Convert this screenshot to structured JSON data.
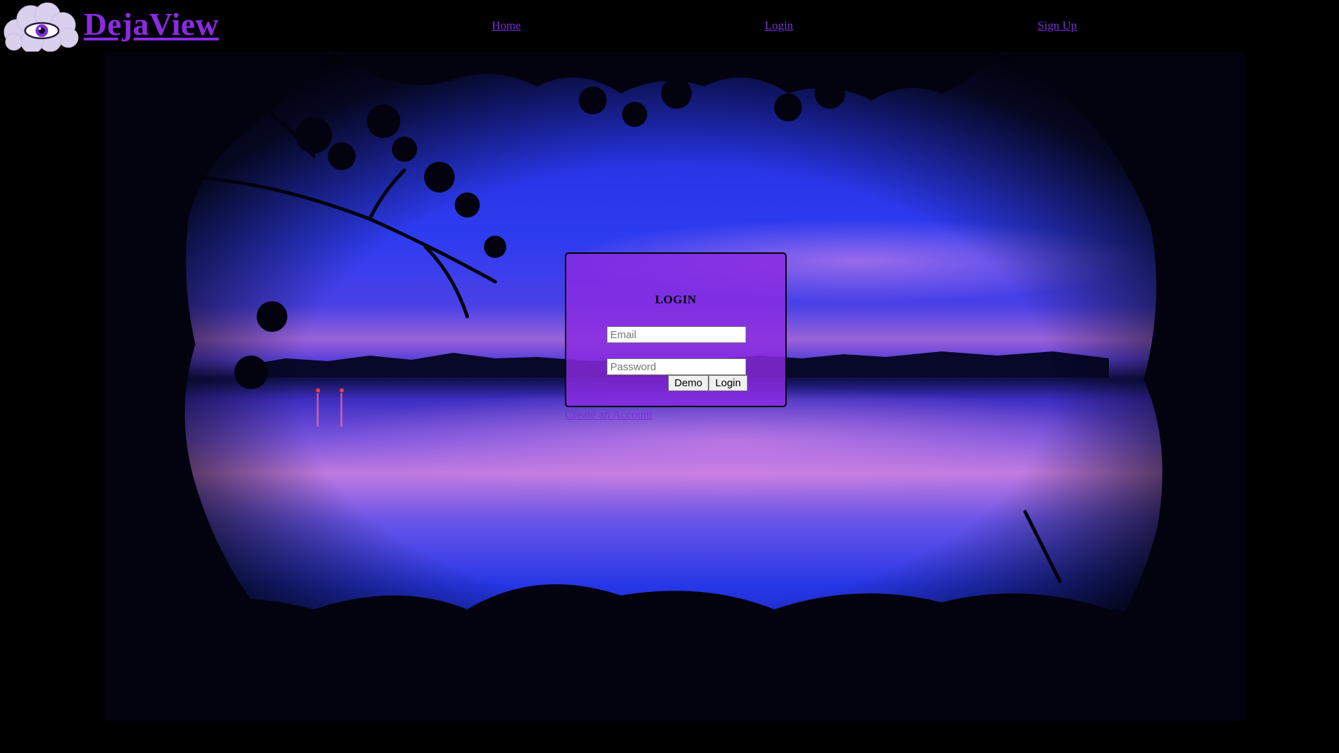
{
  "header": {
    "brand": "DejaView",
    "nav": {
      "home": "Home",
      "login": "Login",
      "signup": "Sign Up"
    }
  },
  "login_card": {
    "title": "LOGIN",
    "email_placeholder": "Email",
    "password_placeholder": "Password",
    "demo_label": "Demo",
    "login_label": "Login"
  },
  "create_account_label": "Create an Account",
  "colors": {
    "accent": "#8a2be2",
    "link": "#7b2fd6",
    "card": "#8b2be2",
    "background": "#000000"
  },
  "icons": {
    "logo": "eye-cloud-icon"
  }
}
